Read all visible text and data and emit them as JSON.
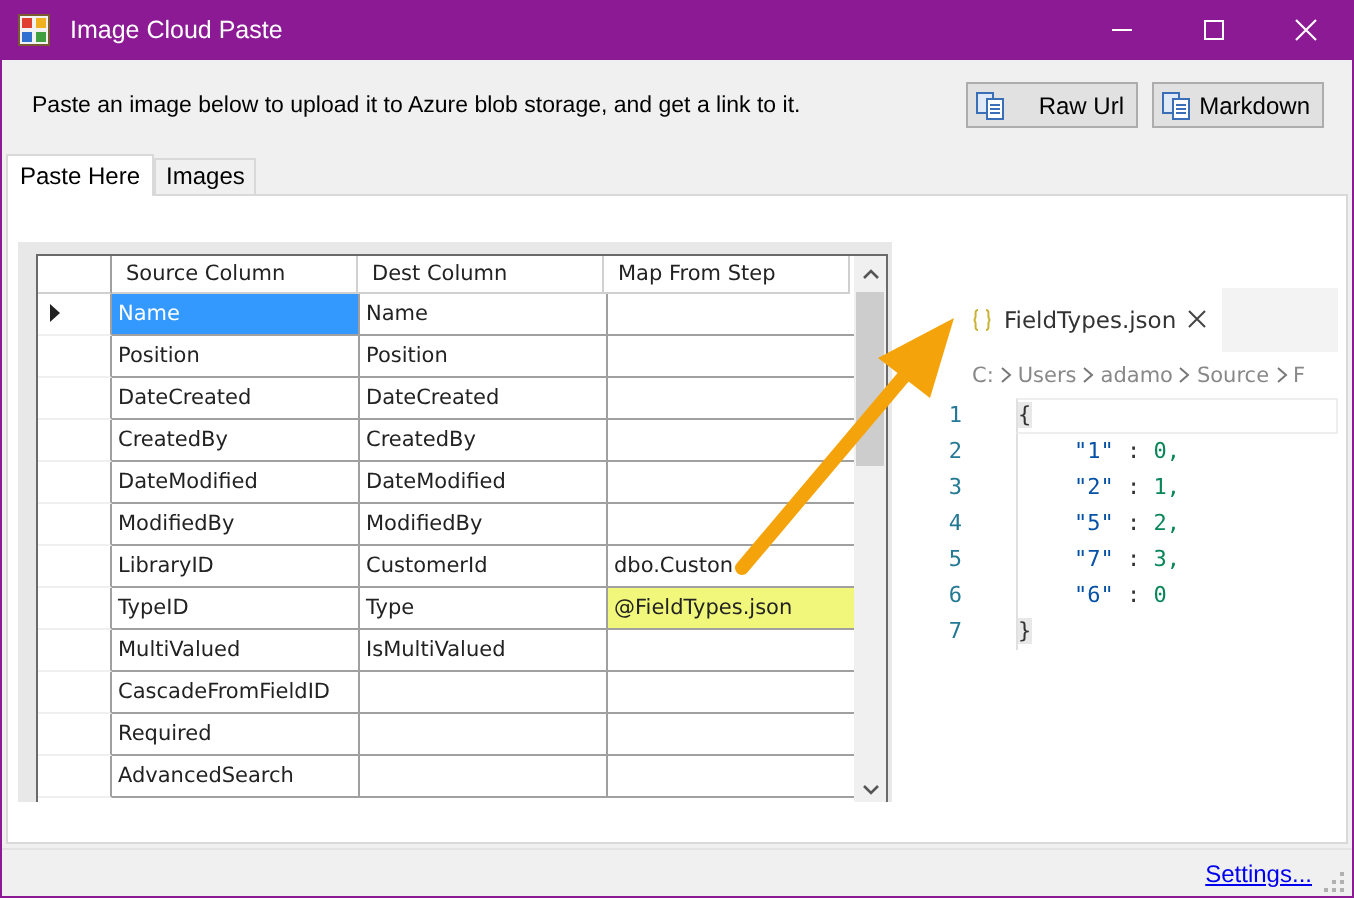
{
  "window": {
    "title": "Image Cloud Paste"
  },
  "description": "Paste an image below to upload it to Azure blob storage, and get a link to it.",
  "buttons": [
    {
      "label": "Raw Url"
    },
    {
      "label": "Markdown"
    }
  ],
  "tabs": [
    {
      "label": "Paste Here",
      "selected": true
    },
    {
      "label": "Images",
      "selected": false
    }
  ],
  "grid": {
    "columns": [
      "Source Column",
      "Dest Column",
      "Map From Step"
    ],
    "rows": [
      {
        "current": true,
        "cells": [
          {
            "text": "Name",
            "selected": true,
            "highlighted": false
          },
          {
            "text": "Name",
            "selected": false,
            "highlighted": false
          },
          {
            "selected": false,
            "highlighted": false
          }
        ]
      },
      {
        "current": false,
        "cells": [
          {
            "text": "Position",
            "selected": false,
            "highlighted": false
          },
          {
            "text": "Position",
            "selected": false,
            "highlighted": false
          },
          {
            "selected": false,
            "highlighted": false
          }
        ]
      },
      {
        "current": false,
        "cells": [
          {
            "text": "DateCreated",
            "selected": false,
            "highlighted": false
          },
          {
            "text": "DateCreated",
            "selected": false,
            "highlighted": false
          },
          {
            "selected": false,
            "highlighted": false
          }
        ]
      },
      {
        "current": false,
        "cells": [
          {
            "text": "CreatedBy",
            "selected": false,
            "highlighted": false
          },
          {
            "text": "CreatedBy",
            "selected": false,
            "highlighted": false
          },
          {
            "selected": false,
            "highlighted": false
          }
        ]
      },
      {
        "current": false,
        "cells": [
          {
            "text": "DateModified",
            "selected": false,
            "highlighted": false
          },
          {
            "text": "DateModified",
            "selected": false,
            "highlighted": false
          },
          {
            "selected": false,
            "highlighted": false
          }
        ]
      },
      {
        "current": false,
        "cells": [
          {
            "text": "ModifiedBy",
            "selected": false,
            "highlighted": false
          },
          {
            "text": "ModifiedBy",
            "selected": false,
            "highlighted": false
          },
          {
            "selected": false,
            "highlighted": false
          }
        ]
      },
      {
        "current": false,
        "cells": [
          {
            "text": "LibraryID",
            "selected": false,
            "highlighted": false
          },
          {
            "text": "CustomerId",
            "selected": false,
            "highlighted": false
          },
          {
            "text": "dbo.Custon",
            "selected": false,
            "highlighted": false
          }
        ]
      },
      {
        "current": false,
        "cells": [
          {
            "text": "TypeID",
            "selected": false,
            "highlighted": false
          },
          {
            "text": "Type",
            "selected": false,
            "highlighted": false
          },
          {
            "text": "@FieldTypes.json",
            "selected": false,
            "highlighted": true
          }
        ]
      },
      {
        "current": false,
        "cells": [
          {
            "text": "MultiValued",
            "selected": false,
            "highlighted": false
          },
          {
            "text": "IsMultiValued",
            "selected": false,
            "highlighted": false
          },
          {
            "selected": false,
            "highlighted": false
          }
        ]
      },
      {
        "current": false,
        "cells": [
          {
            "text": "CascadeFromFieldID",
            "selected": false,
            "highlighted": false
          },
          {
            "selected": false,
            "highlighted": false
          },
          {
            "selected": false,
            "highlighted": false
          }
        ]
      },
      {
        "current": false,
        "cells": [
          {
            "text": "Required",
            "selected": false,
            "highlighted": false
          },
          {
            "selected": false,
            "highlighted": false
          },
          {
            "selected": false,
            "highlighted": false
          }
        ]
      },
      {
        "current": false,
        "cells": [
          {
            "text": "AdvancedSearch",
            "selected": false,
            "highlighted": false
          },
          {
            "selected": false,
            "highlighted": false
          },
          {
            "selected": false,
            "highlighted": false
          }
        ]
      }
    ]
  },
  "editor": {
    "tab": {
      "label": "FieldTypes.json"
    },
    "breadcrumb": [
      "C:",
      "Users",
      "adamo",
      "Source",
      "F"
    ],
    "lines": [
      {
        "number": "1",
        "kind": "brace",
        "text": "{"
      },
      {
        "number": "2",
        "kind": "entry",
        "key": "\"1\"",
        "sep": " : ",
        "value": "0,"
      },
      {
        "number": "3",
        "kind": "entry",
        "key": "\"2\"",
        "sep": " : ",
        "value": "1,"
      },
      {
        "number": "4",
        "kind": "entry",
        "key": "\"5\"",
        "sep": " : ",
        "value": "2,"
      },
      {
        "number": "5",
        "kind": "entry",
        "key": "\"7\"",
        "sep": " : ",
        "value": "3,"
      },
      {
        "number": "6",
        "kind": "entry",
        "key": "\"6\"",
        "sep": " : ",
        "value": "0"
      },
      {
        "number": "7",
        "kind": "brace",
        "text": "}"
      }
    ]
  },
  "footer": {
    "link": "Settings..."
  }
}
